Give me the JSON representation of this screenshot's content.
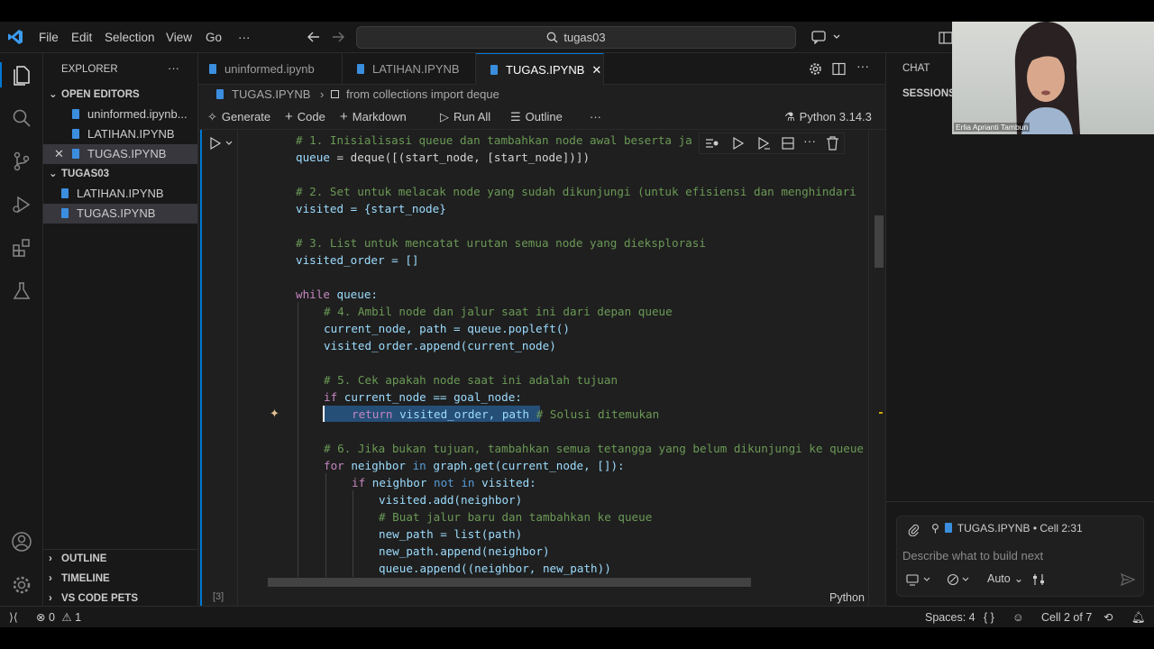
{
  "menu": {
    "items": [
      "File",
      "Edit",
      "Selection",
      "View",
      "Go",
      "···"
    ],
    "search": "tugas03"
  },
  "sidebar": {
    "title": "EXPLORER",
    "more": "···",
    "open_editors_label": "OPEN EDITORS",
    "open_editors": [
      "uninformed.ipynb...",
      "LATIHAN.IPYNB",
      "TUGAS.IPYNB"
    ],
    "folder_label": "TUGAS03",
    "folder_files": [
      "LATIHAN.IPYNB",
      "TUGAS.IPYNB"
    ],
    "outline": "OUTLINE",
    "timeline": "TIMELINE",
    "pets": "VS CODE PETS"
  },
  "tabs": [
    {
      "label": "uninformed.ipynb"
    },
    {
      "label": "LATIHAN.IPYNB"
    },
    {
      "label": "TUGAS.IPYNB"
    }
  ],
  "breadcrumb": {
    "file": "TUGAS.IPYNB",
    "sep": "›",
    "symbol": "from collections import deque"
  },
  "toolbar": {
    "generate": "Generate",
    "code": "Code",
    "markdown": "Markdown",
    "run_all": "Run All",
    "outline": "Outline",
    "more": "···",
    "kernel": "Python 3.14.3"
  },
  "cell": {
    "exec_count": "[3]",
    "language": "Python"
  },
  "code": {
    "l1": "# 1. Inisialisasi queue dan tambahkan node awal beserta ja",
    "l2_var": "queue",
    "l2_rest": " = deque([(start_node, [start_node])])",
    "l4": "# 2. Set untuk melacak node yang sudah dikunjungi (untuk efisiensi dan menghindari",
    "l5": "visited = {start_node}",
    "l7": "# 3. List untuk mencatat urutan semua node yang dieksplorasi",
    "l8": "visited_order = []",
    "l10_kw": "while",
    "l10_rest": " queue:",
    "l11": "# 4. Ambil node dan jalur saat ini dari depan queue",
    "l12": "current_node, path = queue.popleft()",
    "l13": "visited_order.append(current_node)",
    "l15": "# 5. Cek apakah node saat ini adalah tujuan",
    "l16_kw": "if",
    "l16_rest": " current_node == goal_node:",
    "l17_kw": "return",
    "l17_rest": " visited_order, path",
    "l17_cm": " # Solusi ditemukan",
    "l19": "# 6. Jika bukan tujuan, tambahkan semua tetangga yang belum dikunjungi ke queue",
    "l20_kw": "for",
    "l20_a": " neighbor ",
    "l20_in": "in",
    "l20_rest": " graph.get(current_node, []):",
    "l21_kw": "if",
    "l21_a": " neighbor ",
    "l21_not": "not in",
    "l21_rest": " visited:",
    "l22": "visited.add(neighbor)",
    "l23": "# Buat jalur baru dan tambahkan ke queue",
    "l24": "new_path = list(path)",
    "l25": "new_path.append(neighbor)",
    "l26": "queue.append((neighbor, new_path))"
  },
  "chat": {
    "title": "CHAT",
    "sessions": "SESSIONS",
    "context": "TUGAS.IPYNB • Cell 2:31",
    "placeholder": "Describe what to build next",
    "mode": "Auto"
  },
  "webcam": {
    "name": "Erlia Aprianti Tambun"
  },
  "status": {
    "errors": "0",
    "warnings": "1",
    "spaces": "Spaces: 4",
    "braces": "{ }",
    "cell": "Cell 2 of 7"
  }
}
